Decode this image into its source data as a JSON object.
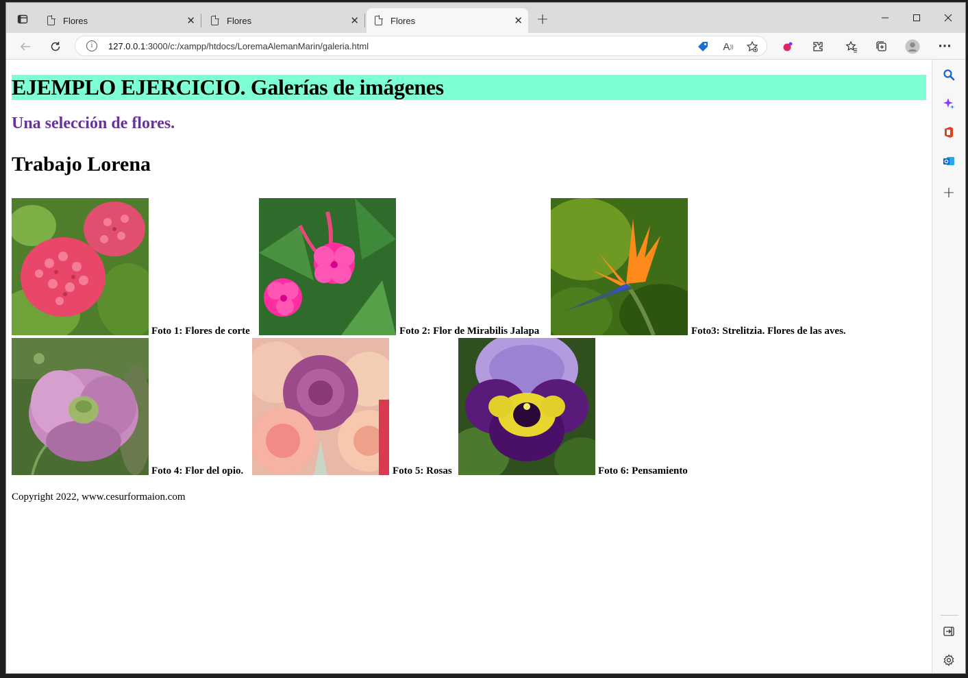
{
  "browser": {
    "tabs": [
      {
        "title": "Flores"
      },
      {
        "title": "Flores"
      },
      {
        "title": "Flores"
      }
    ],
    "url_host": "127.0.0.1",
    "url_rest": ":3000/c:/xampp/htdocs/LoremaAlemanMarin/galeria.html"
  },
  "page": {
    "heading": "EJEMPLO EJERCICIO. Galerías de imágenes",
    "subtitle": "Una selección de flores.",
    "section_title": "Trabajo Lorena",
    "gallery": [
      {
        "caption": "Foto 1: Flores de corte",
        "image": "hydrangea"
      },
      {
        "caption": "Foto 2: Flor de Mirabilis Jalapa",
        "image": "mirabilis"
      },
      {
        "caption": "Foto3: Strelitzia. Flores de las aves.",
        "image": "strelitzia"
      },
      {
        "caption": "Foto 4: Flor del opio.",
        "image": "poppy"
      },
      {
        "caption": "Foto 5: Rosas",
        "image": "roses"
      },
      {
        "caption": "Foto 6: Pensamiento",
        "image": "pansy"
      }
    ],
    "footer": "Copyright 2022, www.cesurformaion.com"
  },
  "colors": {
    "heading_bg": "#7fffd4",
    "subtitle": "#663399"
  }
}
